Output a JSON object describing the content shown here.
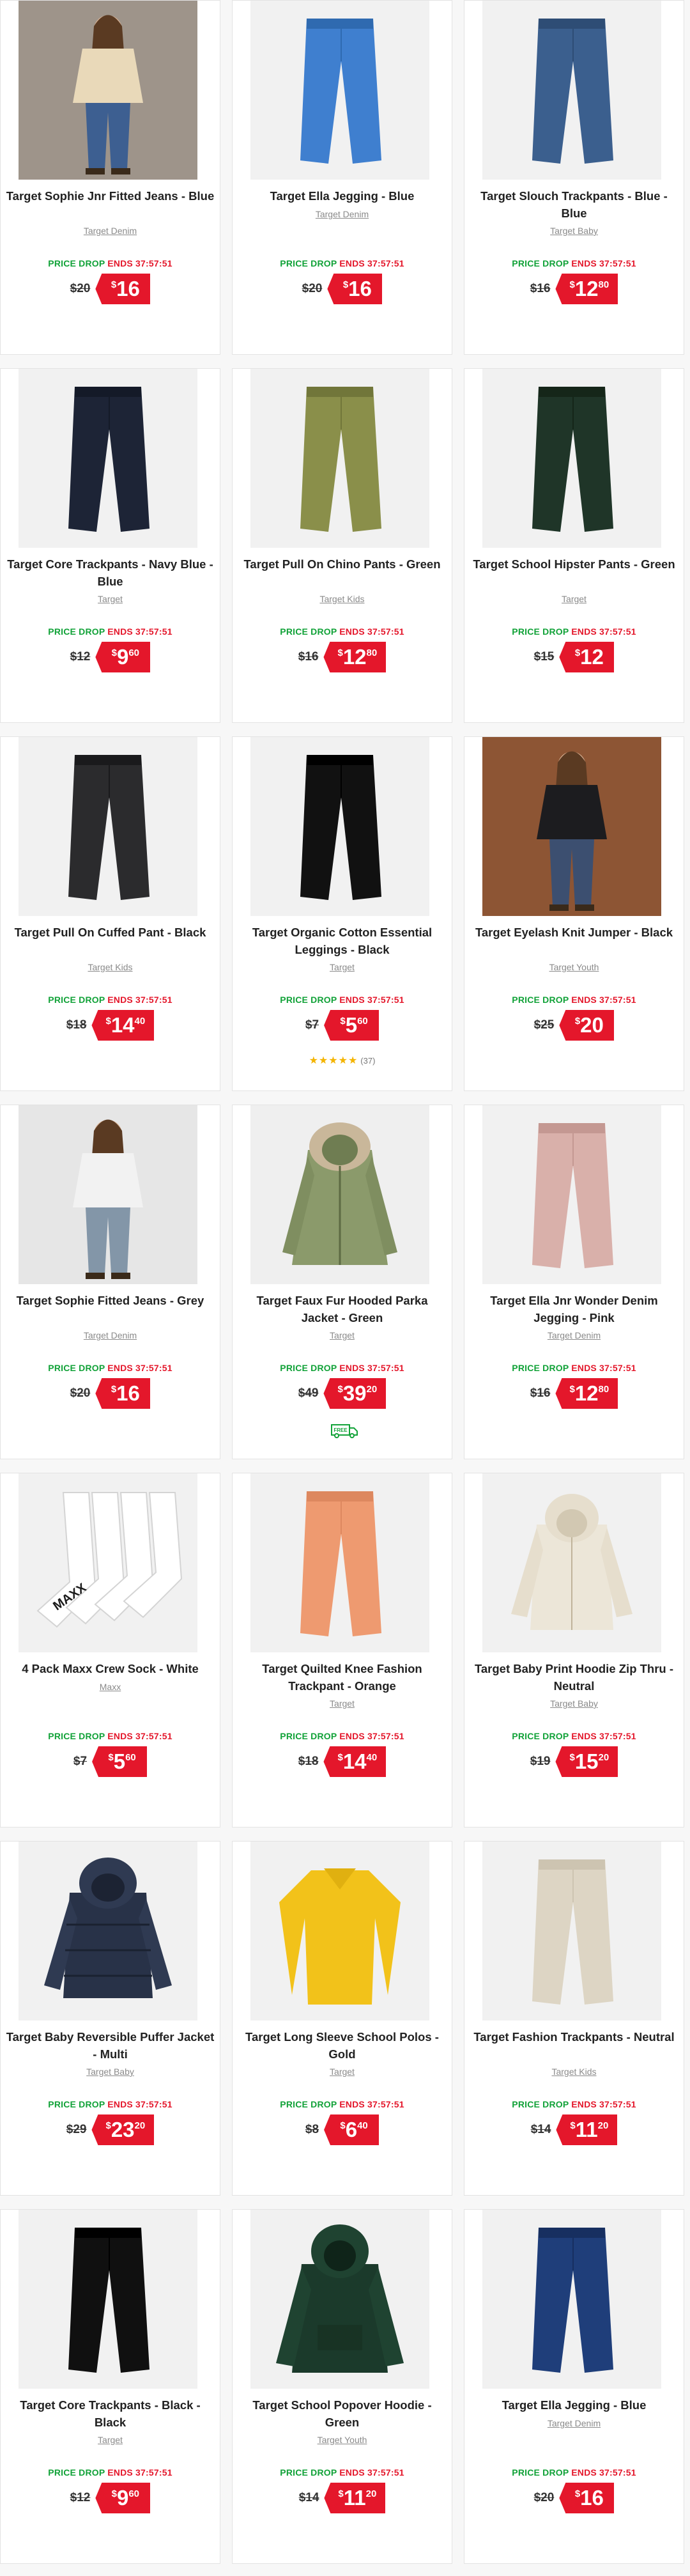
{
  "colors": {
    "price_red": "#e4172b",
    "price_drop_green": "#11a238",
    "star": "#f4b400"
  },
  "promo": {
    "drop": "PRICE DROP",
    "ends": "ENDS 37:57:51"
  },
  "products": [
    {
      "name": "Target Sophie Jnr Fitted Jeans - Blue",
      "brand": "Target Denim",
      "was": "$20",
      "currency": "$",
      "dollars": "16",
      "cents": "",
      "image": "girl-in-jeans-photo"
    },
    {
      "name": "Target Ella Jegging - Blue",
      "brand": "Target Denim",
      "was": "$20",
      "currency": "$",
      "dollars": "16",
      "cents": "",
      "image": "blue-jegging-photo"
    },
    {
      "name": "Target Slouch Trackpants - Blue - Blue",
      "brand": "Target Baby",
      "was": "$16",
      "currency": "$",
      "dollars": "12",
      "cents": "80",
      "image": "blue-trackpants-photo"
    },
    {
      "name": "Target Core Trackpants - Navy Blue - Blue",
      "brand": "Target",
      "was": "$12",
      "currency": "$",
      "dollars": "9",
      "cents": "60",
      "image": "navy-trackpants-photo"
    },
    {
      "name": "Target Pull On Chino Pants - Green",
      "brand": "Target Kids",
      "was": "$16",
      "currency": "$",
      "dollars": "12",
      "cents": "80",
      "image": "green-chino-photo"
    },
    {
      "name": "Target School Hipster Pants - Green",
      "brand": "Target",
      "was": "$15",
      "currency": "$",
      "dollars": "12",
      "cents": "",
      "image": "green-school-pants-photo"
    },
    {
      "name": "Target Pull On Cuffed Pant - Black",
      "brand": "Target Kids",
      "was": "$18",
      "currency": "$",
      "dollars": "14",
      "cents": "40",
      "image": "black-cuffed-pant-photo"
    },
    {
      "name": "Target Organic Cotton Essential Leggings - Black",
      "brand": "Target",
      "was": "$7",
      "currency": "$",
      "dollars": "5",
      "cents": "60",
      "image": "black-leggings-photo",
      "rating": {
        "stars": "★★★★★",
        "count": "(37)"
      }
    },
    {
      "name": "Target Eyelash Knit Jumper - Black",
      "brand": "Target Youth",
      "was": "$25",
      "currency": "$",
      "dollars": "20",
      "cents": "",
      "image": "girl-black-jumper-photo"
    },
    {
      "name": "Target Sophie Fitted Jeans - Grey",
      "brand": "Target Denim",
      "was": "$20",
      "currency": "$",
      "dollars": "16",
      "cents": "",
      "image": "grey-jeans-photo"
    },
    {
      "name": "Target Faux Fur Hooded Parka Jacket - Green",
      "brand": "Target",
      "was": "$49",
      "currency": "$",
      "dollars": "39",
      "cents": "20",
      "image": "green-parka-photo",
      "free_badge": "FREE"
    },
    {
      "name": "Target Ella Jnr Wonder Denim Jegging - Pink",
      "brand": "Target Denim",
      "was": "$16",
      "currency": "$",
      "dollars": "12",
      "cents": "80",
      "image": "pink-jegging-photo"
    },
    {
      "name": "4 Pack Maxx Crew Sock - White",
      "brand": "Maxx",
      "was": "$7",
      "currency": "$",
      "dollars": "5",
      "cents": "60",
      "image": "white-socks-photo",
      "logo_text": "MAXX"
    },
    {
      "name": "Target Quilted Knee Fashion Trackpant - Orange",
      "brand": "Target",
      "was": "$18",
      "currency": "$",
      "dollars": "14",
      "cents": "40",
      "image": "orange-trackpant-photo"
    },
    {
      "name": "Target Baby Print Hoodie Zip Thru - Neutral",
      "brand": "Target Baby",
      "was": "$19",
      "currency": "$",
      "dollars": "15",
      "cents": "20",
      "image": "neutral-hoodie-photo"
    },
    {
      "name": "Target Baby Reversible Puffer Jacket - Multi",
      "brand": "Target Baby",
      "was": "$29",
      "currency": "$",
      "dollars": "23",
      "cents": "20",
      "image": "navy-puffer-photo"
    },
    {
      "name": "Target Long Sleeve School Polos - Gold",
      "brand": "Target",
      "was": "$8",
      "currency": "$",
      "dollars": "6",
      "cents": "40",
      "image": "gold-polo-photo"
    },
    {
      "name": "Target Fashion Trackpants - Neutral",
      "brand": "Target Kids",
      "was": "$14",
      "currency": "$",
      "dollars": "11",
      "cents": "20",
      "image": "neutral-trackpants-photo"
    },
    {
      "name": "Target Core Trackpants - Black - Black",
      "brand": "Target",
      "was": "$12",
      "currency": "$",
      "dollars": "9",
      "cents": "60",
      "image": "black-trackpants-photo"
    },
    {
      "name": "Target School Popover Hoodie - Green",
      "brand": "Target Youth",
      "was": "$14",
      "currency": "$",
      "dollars": "11",
      "cents": "20",
      "image": "green-hoodie-photo"
    },
    {
      "name": "Target Ella Jegging - Blue",
      "brand": "Target Denim",
      "was": "$20",
      "currency": "$",
      "dollars": "16",
      "cents": "",
      "image": "dark-blue-jegging-photo"
    }
  ]
}
